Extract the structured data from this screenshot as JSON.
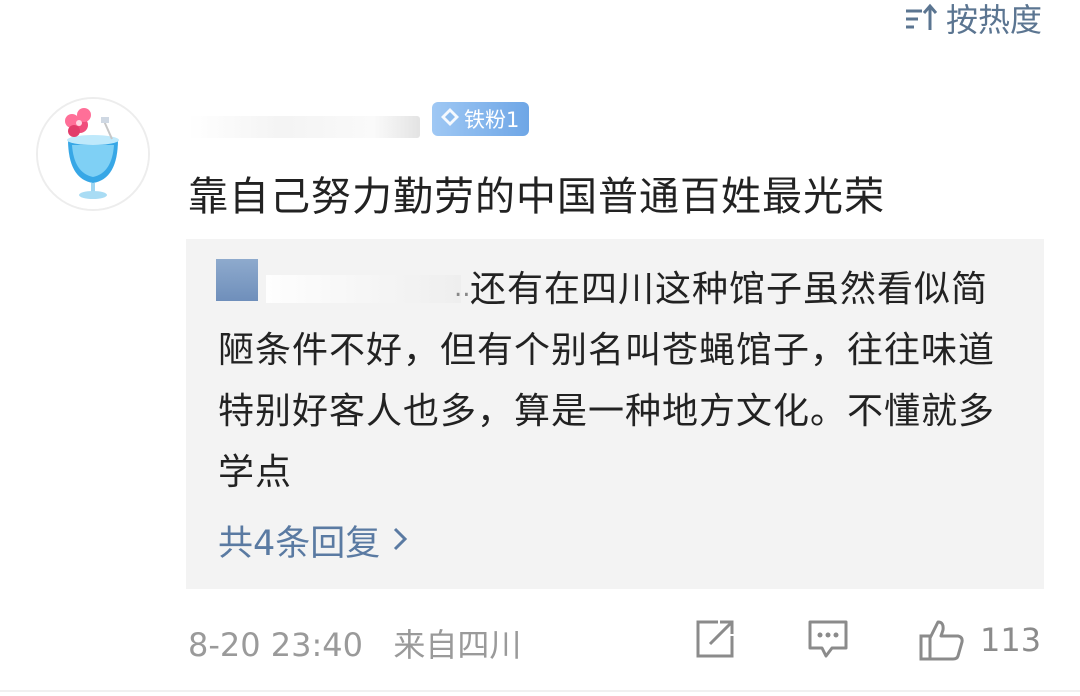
{
  "header": {
    "sort_label": "按热度",
    "sort_icon": "sort-icon"
  },
  "comment": {
    "avatar_icon": "cocktail-avatar",
    "fan_badge": "铁粉1",
    "text": "靠自己努力勤劳的中国普通百姓最光荣",
    "reply": {
      "ellipsis": "..",
      "text": "还有在四川这种馆子虽然看似简陋条件不好，但有个别名叫苍蝇馆子，往往味道特别好客人也多，算是一种地方文化。不懂就多学点",
      "count_label": "共4条回复"
    },
    "meta": {
      "time": "8-20 23:40",
      "location": "来自四川"
    },
    "actions": {
      "share_icon": "share-icon",
      "comment_icon": "comment-icon",
      "like_icon": "thumbs-up-icon",
      "like_count": "113"
    }
  }
}
